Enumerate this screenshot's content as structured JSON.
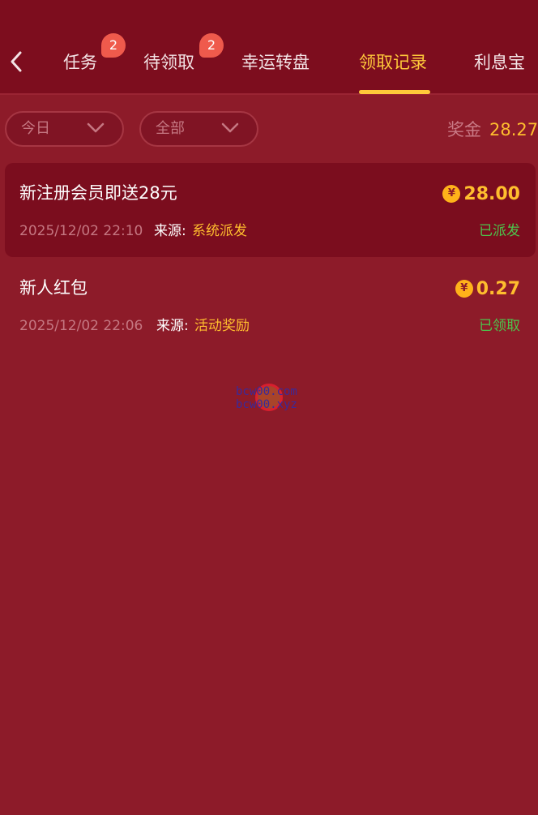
{
  "header": {
    "tabs": [
      {
        "label": "任务",
        "badge": "2",
        "active": false
      },
      {
        "label": "待领取",
        "badge": "2",
        "active": false
      },
      {
        "label": "幸运转盘",
        "badge": "",
        "active": false
      },
      {
        "label": "领取记录",
        "badge": "",
        "active": true
      },
      {
        "label": "利息宝",
        "badge": "",
        "active": false
      }
    ]
  },
  "filters": {
    "date": {
      "selected": "今日"
    },
    "category": {
      "selected": "全部"
    }
  },
  "summary": {
    "bonus_label": "奖金",
    "bonus_value": "28.27"
  },
  "records": [
    {
      "title": "新注册会员即送28元",
      "amount": "28.00",
      "time": "2025/12/02 22:10",
      "source_label": "来源:",
      "source": "系统派发",
      "status": "已派发"
    },
    {
      "title": "新人红包",
      "amount": "0.27",
      "time": "2025/12/02 22:06",
      "source_label": "来源:",
      "source": "活动奖励",
      "status": "已领取"
    }
  ],
  "watermark": {
    "line1": "bcw00.com",
    "line2": "bcw00.xyz"
  },
  "icons": {
    "back": "chevron-left-icon",
    "dropdown": "chevron-down-icon",
    "currency": "yen-coin-icon"
  },
  "colors": {
    "background": "#8d1b29",
    "header": "#7d0d1e",
    "accent": "#ffc93a",
    "gold": "#ffbe2e",
    "badge": "#ef5a4c",
    "status_green": "#4cc44c"
  }
}
